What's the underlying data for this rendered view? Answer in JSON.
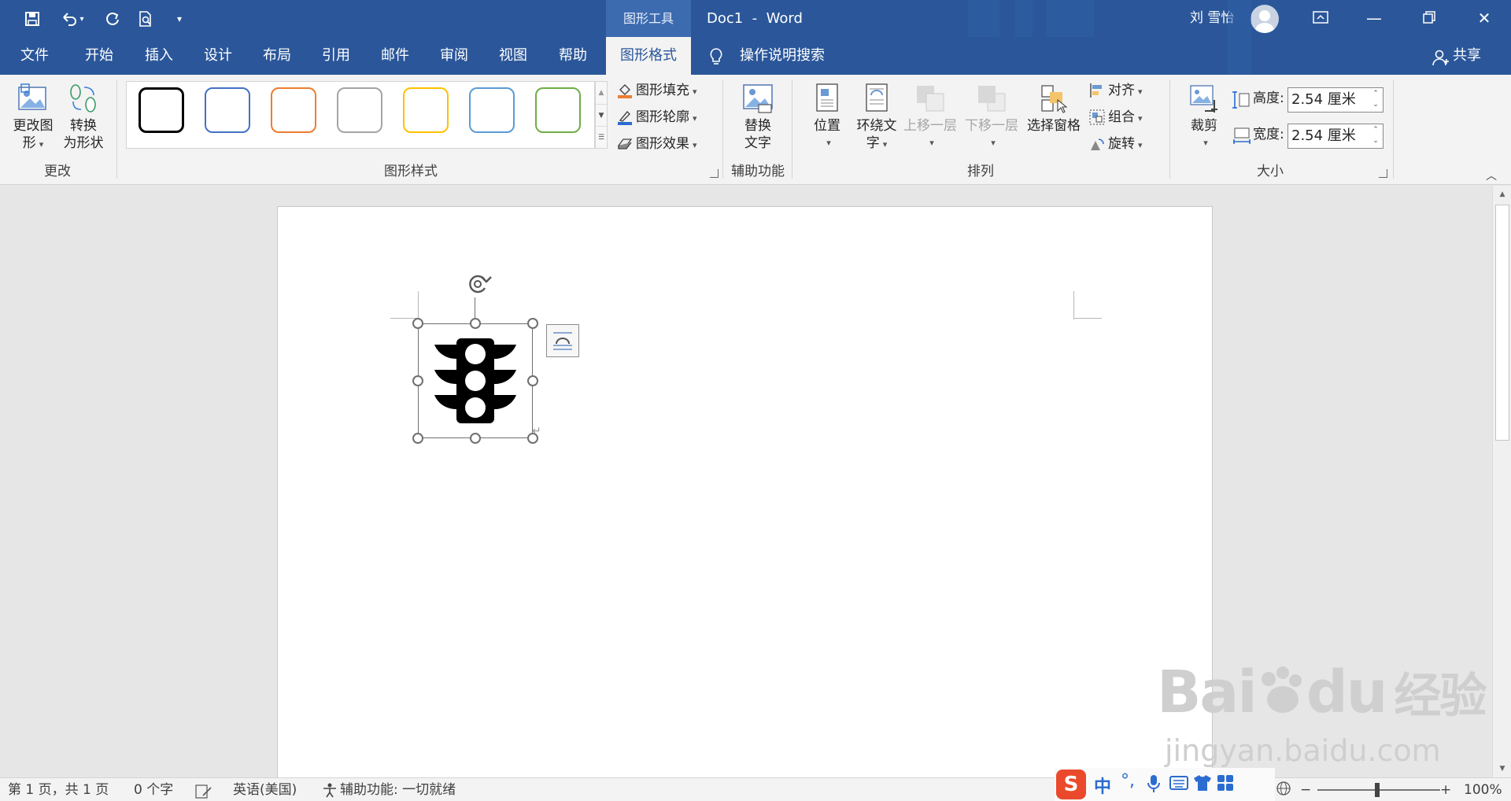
{
  "app": {
    "context_group": "图形工具",
    "doc_title": "Doc1  -  Word",
    "user_name": "刘 雪怡"
  },
  "quick_access": {
    "icons": [
      "save-icon",
      "undo-icon",
      "redo-icon",
      "print-preview-icon",
      "customize-qat-icon"
    ]
  },
  "tabs": [
    {
      "label": "文件",
      "active": false
    },
    {
      "label": "开始",
      "active": false
    },
    {
      "label": "插入",
      "active": false
    },
    {
      "label": "设计",
      "active": false
    },
    {
      "label": "布局",
      "active": false
    },
    {
      "label": "引用",
      "active": false
    },
    {
      "label": "邮件",
      "active": false
    },
    {
      "label": "审阅",
      "active": false
    },
    {
      "label": "视图",
      "active": false
    },
    {
      "label": "帮助",
      "active": false
    },
    {
      "label": "图形格式",
      "active": true
    }
  ],
  "tell_me": "操作说明搜索",
  "share": "共享",
  "ribbon": {
    "change": {
      "label": "更改",
      "change_shape_line1": "更改图",
      "change_shape_line2": "形",
      "convert_line1": "转换",
      "convert_line2": "为形状"
    },
    "styles": {
      "label": "图形样式",
      "swatch_colors": [
        "#000000",
        "#4472c4",
        "#ed7d31",
        "#a5a5a5",
        "#ffc000",
        "#5b9bd5",
        "#70ad47"
      ],
      "fill": "图形填充",
      "outline": "图形轮廓",
      "effects": "图形效果"
    },
    "accessibility": {
      "label": "辅助功能",
      "alt_text_line1": "替换",
      "alt_text_line2": "文字"
    },
    "arrange": {
      "label": "排列",
      "position": "位置",
      "wrap_line1": "环绕文",
      "wrap_line2": "字",
      "bring_forward": "上移一层",
      "send_backward": "下移一层",
      "selection_pane": "选择窗格",
      "align": "对齐",
      "group": "组合",
      "rotate": "旋转"
    },
    "size": {
      "label": "大小",
      "crop": "裁剪",
      "height_label": "高度:",
      "height_value": "2.54 厘米",
      "width_label": "宽度:",
      "width_value": "2.54 厘米"
    }
  },
  "statusbar": {
    "page": "第 1 页，共 1 页",
    "words": "0 个字",
    "language": "英语(美国)",
    "accessibility": "辅助功能: 一切就绪",
    "zoom": "100%",
    "ime_chinese": "中"
  },
  "watermark": {
    "brand": "Bai",
    "brand2": "du",
    "brand3": "经验",
    "url": "jingyan.baidu.com"
  }
}
